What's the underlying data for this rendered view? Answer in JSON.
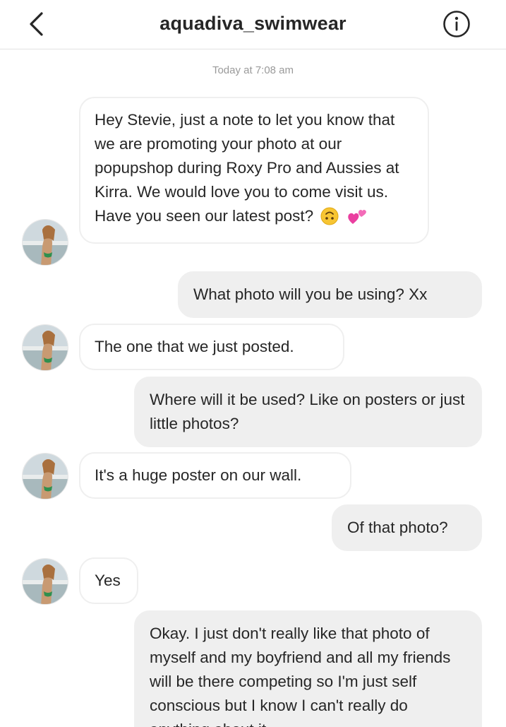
{
  "header": {
    "back_icon": "chevron-left-icon",
    "title": "aquadiva_swimwear",
    "info_icon": "info-circle-icon"
  },
  "thread": {
    "timestamp": "Today at 7:08 am",
    "messages": [
      {
        "from": "them",
        "text": "Hey Stevie, just a note to let you know that we are promoting your photo at our popupshop during Roxy Pro and Aussies at Kirra. We would love you to come visit us. Have you seen our latest post?",
        "emoji": [
          "upside-down-face-emoji",
          "two-hearts-emoji"
        ]
      },
      {
        "from": "me",
        "text": "What photo will you be using? Xx"
      },
      {
        "from": "them",
        "text": "The one that we just posted."
      },
      {
        "from": "me",
        "text": "Where will it be used? Like on posters or just little photos?"
      },
      {
        "from": "them",
        "text": "It's a huge poster on our wall."
      },
      {
        "from": "me",
        "text": "Of that photo?"
      },
      {
        "from": "them",
        "text": "Yes"
      },
      {
        "from": "me",
        "text": "Okay. I just don't really like that photo of myself and my boyfriend and all my friends will be there competing so I'm just self conscious but I know I can't really do anything about it."
      }
    ]
  },
  "colors": {
    "incoming_bubble": "#ffffff",
    "outgoing_bubble": "#efefef",
    "text": "#262626",
    "timestamp": "#9a9a9a"
  }
}
